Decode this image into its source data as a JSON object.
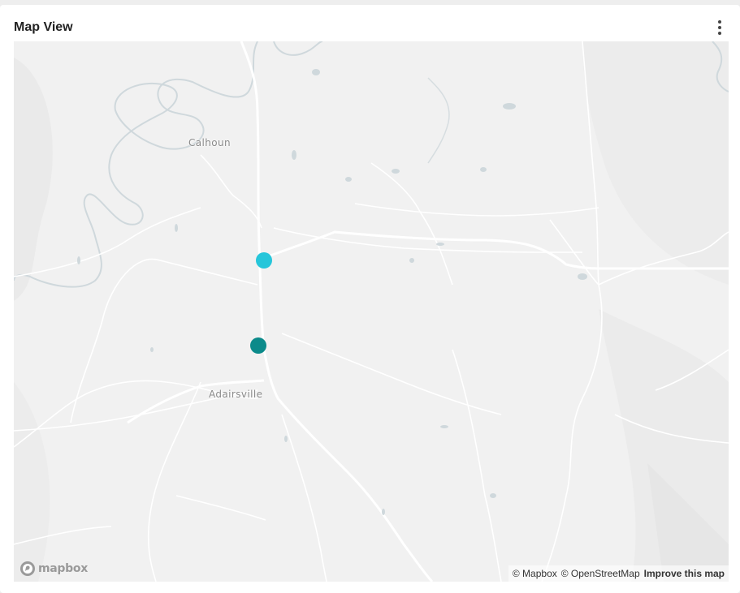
{
  "card": {
    "title": "Map View",
    "menu_icon": "more-vertical-icon"
  },
  "map": {
    "places": [
      {
        "name": "Calhoun"
      },
      {
        "name": "Adairsville"
      }
    ],
    "markers": [
      {
        "color": "#26c6da"
      },
      {
        "color": "#0b8a8a"
      }
    ],
    "logo": {
      "text": "mapbox",
      "icon": "mapbox-logo-icon"
    },
    "attribution": {
      "mapbox": "© Mapbox",
      "osm": "© OpenStreetMap",
      "improve": "Improve this map"
    }
  }
}
